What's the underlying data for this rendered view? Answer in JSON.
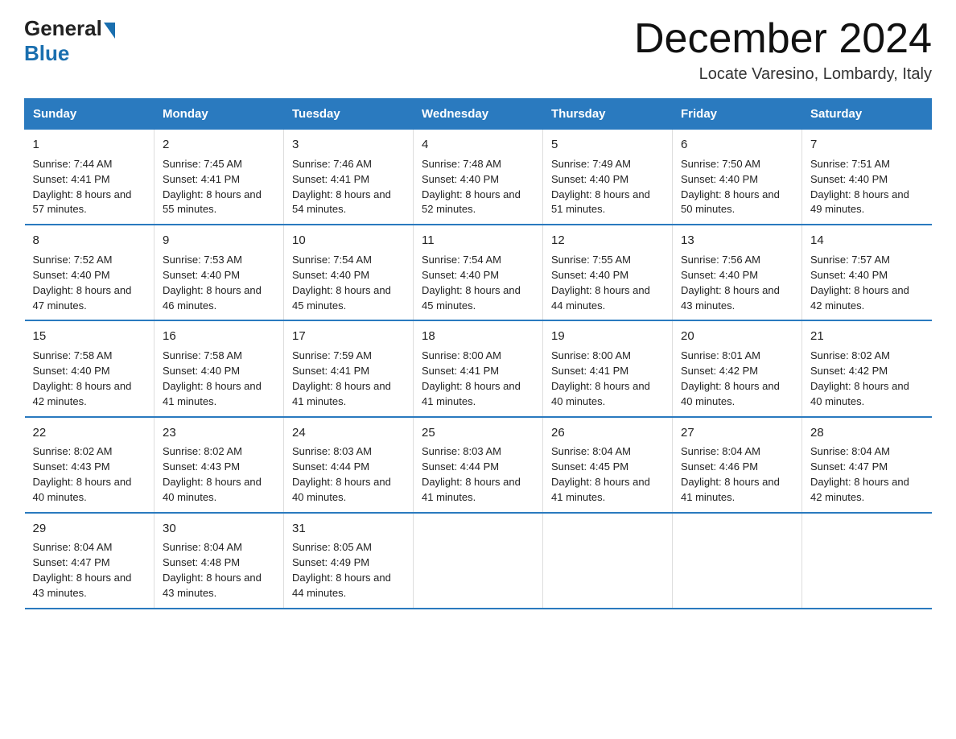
{
  "header": {
    "logo_general": "General",
    "logo_blue": "Blue",
    "main_title": "December 2024",
    "subtitle": "Locate Varesino, Lombardy, Italy"
  },
  "columns": [
    "Sunday",
    "Monday",
    "Tuesday",
    "Wednesday",
    "Thursday",
    "Friday",
    "Saturday"
  ],
  "weeks": [
    [
      {
        "day": "1",
        "sunrise": "7:44 AM",
        "sunset": "4:41 PM",
        "daylight": "8 hours and 57 minutes."
      },
      {
        "day": "2",
        "sunrise": "7:45 AM",
        "sunset": "4:41 PM",
        "daylight": "8 hours and 55 minutes."
      },
      {
        "day": "3",
        "sunrise": "7:46 AM",
        "sunset": "4:41 PM",
        "daylight": "8 hours and 54 minutes."
      },
      {
        "day": "4",
        "sunrise": "7:48 AM",
        "sunset": "4:40 PM",
        "daylight": "8 hours and 52 minutes."
      },
      {
        "day": "5",
        "sunrise": "7:49 AM",
        "sunset": "4:40 PM",
        "daylight": "8 hours and 51 minutes."
      },
      {
        "day": "6",
        "sunrise": "7:50 AM",
        "sunset": "4:40 PM",
        "daylight": "8 hours and 50 minutes."
      },
      {
        "day": "7",
        "sunrise": "7:51 AM",
        "sunset": "4:40 PM",
        "daylight": "8 hours and 49 minutes."
      }
    ],
    [
      {
        "day": "8",
        "sunrise": "7:52 AM",
        "sunset": "4:40 PM",
        "daylight": "8 hours and 47 minutes."
      },
      {
        "day": "9",
        "sunrise": "7:53 AM",
        "sunset": "4:40 PM",
        "daylight": "8 hours and 46 minutes."
      },
      {
        "day": "10",
        "sunrise": "7:54 AM",
        "sunset": "4:40 PM",
        "daylight": "8 hours and 45 minutes."
      },
      {
        "day": "11",
        "sunrise": "7:54 AM",
        "sunset": "4:40 PM",
        "daylight": "8 hours and 45 minutes."
      },
      {
        "day": "12",
        "sunrise": "7:55 AM",
        "sunset": "4:40 PM",
        "daylight": "8 hours and 44 minutes."
      },
      {
        "day": "13",
        "sunrise": "7:56 AM",
        "sunset": "4:40 PM",
        "daylight": "8 hours and 43 minutes."
      },
      {
        "day": "14",
        "sunrise": "7:57 AM",
        "sunset": "4:40 PM",
        "daylight": "8 hours and 42 minutes."
      }
    ],
    [
      {
        "day": "15",
        "sunrise": "7:58 AM",
        "sunset": "4:40 PM",
        "daylight": "8 hours and 42 minutes."
      },
      {
        "day": "16",
        "sunrise": "7:58 AM",
        "sunset": "4:40 PM",
        "daylight": "8 hours and 41 minutes."
      },
      {
        "day": "17",
        "sunrise": "7:59 AM",
        "sunset": "4:41 PM",
        "daylight": "8 hours and 41 minutes."
      },
      {
        "day": "18",
        "sunrise": "8:00 AM",
        "sunset": "4:41 PM",
        "daylight": "8 hours and 41 minutes."
      },
      {
        "day": "19",
        "sunrise": "8:00 AM",
        "sunset": "4:41 PM",
        "daylight": "8 hours and 40 minutes."
      },
      {
        "day": "20",
        "sunrise": "8:01 AM",
        "sunset": "4:42 PM",
        "daylight": "8 hours and 40 minutes."
      },
      {
        "day": "21",
        "sunrise": "8:02 AM",
        "sunset": "4:42 PM",
        "daylight": "8 hours and 40 minutes."
      }
    ],
    [
      {
        "day": "22",
        "sunrise": "8:02 AM",
        "sunset": "4:43 PM",
        "daylight": "8 hours and 40 minutes."
      },
      {
        "day": "23",
        "sunrise": "8:02 AM",
        "sunset": "4:43 PM",
        "daylight": "8 hours and 40 minutes."
      },
      {
        "day": "24",
        "sunrise": "8:03 AM",
        "sunset": "4:44 PM",
        "daylight": "8 hours and 40 minutes."
      },
      {
        "day": "25",
        "sunrise": "8:03 AM",
        "sunset": "4:44 PM",
        "daylight": "8 hours and 41 minutes."
      },
      {
        "day": "26",
        "sunrise": "8:04 AM",
        "sunset": "4:45 PM",
        "daylight": "8 hours and 41 minutes."
      },
      {
        "day": "27",
        "sunrise": "8:04 AM",
        "sunset": "4:46 PM",
        "daylight": "8 hours and 41 minutes."
      },
      {
        "day": "28",
        "sunrise": "8:04 AM",
        "sunset": "4:47 PM",
        "daylight": "8 hours and 42 minutes."
      }
    ],
    [
      {
        "day": "29",
        "sunrise": "8:04 AM",
        "sunset": "4:47 PM",
        "daylight": "8 hours and 43 minutes."
      },
      {
        "day": "30",
        "sunrise": "8:04 AM",
        "sunset": "4:48 PM",
        "daylight": "8 hours and 43 minutes."
      },
      {
        "day": "31",
        "sunrise": "8:05 AM",
        "sunset": "4:49 PM",
        "daylight": "8 hours and 44 minutes."
      },
      null,
      null,
      null,
      null
    ]
  ]
}
